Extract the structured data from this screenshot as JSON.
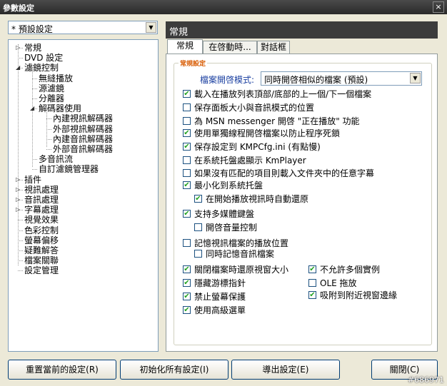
{
  "window": {
    "title": "參數設定",
    "close_glyph": "×"
  },
  "preset": {
    "value": "* 預設設定"
  },
  "tree": [
    {
      "label": "常規",
      "level": 0,
      "expander": "▷",
      "row": 0
    },
    {
      "label": "DVD 設定",
      "level": 0,
      "expander": "",
      "row": 1
    },
    {
      "label": "濾鏡控制",
      "level": 0,
      "expander": "◢",
      "row": 2
    },
    {
      "label": "無縫播放",
      "level": 1,
      "expander": "",
      "row": 3
    },
    {
      "label": "源濾鏡",
      "level": 1,
      "expander": "",
      "row": 4
    },
    {
      "label": "分離器",
      "level": 1,
      "expander": "",
      "row": 5
    },
    {
      "label": "解碼器使用",
      "level": 1,
      "expander": "◢",
      "row": 6
    },
    {
      "label": "內建視訊解碼器",
      "level": 2,
      "expander": "",
      "row": 7
    },
    {
      "label": "外部視訊解碼器",
      "level": 2,
      "expander": "",
      "row": 8
    },
    {
      "label": "內建音訊解碼器",
      "level": 2,
      "expander": "",
      "row": 9
    },
    {
      "label": "外部音訊解碼器",
      "level": 2,
      "expander": "",
      "row": 10
    },
    {
      "label": "多音訊流",
      "level": 1,
      "expander": "",
      "row": 11
    },
    {
      "label": "自訂濾鏡管理器",
      "level": 1,
      "expander": "",
      "row": 12
    },
    {
      "label": "插件",
      "level": 0,
      "expander": "▷",
      "row": 13
    },
    {
      "label": "視訊處理",
      "level": 0,
      "expander": "▷",
      "row": 14
    },
    {
      "label": "音訊處理",
      "level": 0,
      "expander": "▷",
      "row": 15
    },
    {
      "label": "字幕處理",
      "level": 0,
      "expander": "▷",
      "row": 16
    },
    {
      "label": "視覺效果",
      "level": 0,
      "expander": "",
      "row": 17
    },
    {
      "label": "色彩控制",
      "level": 0,
      "expander": "",
      "row": 18
    },
    {
      "label": "螢幕偏移",
      "level": 0,
      "expander": "",
      "row": 19
    },
    {
      "label": "疑難解答",
      "level": 0,
      "expander": "",
      "row": 20
    },
    {
      "label": "檔案關聯",
      "level": 0,
      "expander": "",
      "row": 21
    },
    {
      "label": "設定管理",
      "level": 0,
      "expander": "",
      "row": 22
    }
  ],
  "panel": {
    "title": "常規"
  },
  "tabs": [
    {
      "label": "常規",
      "active": true
    },
    {
      "label": "在啓動時...",
      "active": false
    },
    {
      "label": "對話框",
      "active": false
    }
  ],
  "group": {
    "legend": "常規設定",
    "open_mode_label": "檔案開啓模式:",
    "open_mode_value": "同時開啓相似的檔案 (預設)"
  },
  "checkboxes": [
    {
      "label": "載入在播放列表頂部/底部的上一個/下一個檔案",
      "checked": true
    },
    {
      "label": "保存面板大小與音訊模式的位置",
      "checked": false
    },
    {
      "label": "為 MSN messenger 開啓 \"正在播放\" 功能",
      "checked": false
    },
    {
      "label": "使用單獨線程開啓檔案以防止程序死鎖",
      "checked": true
    },
    {
      "label": "保存設定到 KMPCfg.ini (有點慢)",
      "checked": true
    },
    {
      "label": "在系統托盤處顯示 KmPlayer",
      "checked": false
    },
    {
      "label": "如果沒有匹配的項目則載入文件夾中的任意字幕",
      "checked": false
    },
    {
      "label": "最小化到系統托盤",
      "checked": true
    },
    {
      "label": "在開始播放視訊時自動還原",
      "checked": true
    },
    {
      "label": "支持多媒體鍵盤",
      "checked": true
    },
    {
      "label": "開啓音量控制",
      "checked": false
    },
    {
      "label": "記憶視訊檔案的播放位置",
      "checked": false
    },
    {
      "label": "同時記憶音訊檔案",
      "checked": false
    },
    {
      "label": "關閉檔案時還原視窗大小",
      "checked": true
    },
    {
      "label": "隱藏游標指針",
      "checked": true
    },
    {
      "label": "禁止螢幕保護",
      "checked": true
    },
    {
      "label": "使用高級選單",
      "checked": true
    },
    {
      "label": "不允許多個實例",
      "checked": true
    },
    {
      "label": "OLE 拖放",
      "checked": false
    },
    {
      "label": "吸附到附近視窗邊緣",
      "checked": true
    }
  ],
  "buttons": {
    "reset": "重置當前的設定(R)",
    "init": "初始化所有設定(I)",
    "export": "導出設定(E)",
    "close": "關閉(C)"
  },
  "watermark": "#686971",
  "check_glyph": "✔",
  "colors": {
    "accent": "#3c3c3c",
    "legend": "#d85a00",
    "check": "#21a121"
  }
}
